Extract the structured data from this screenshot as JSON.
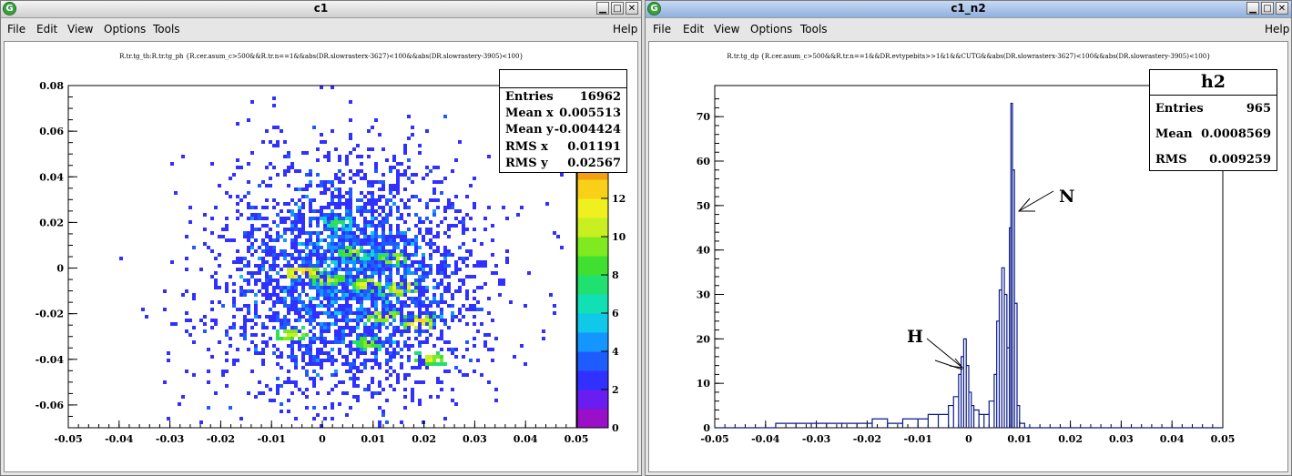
{
  "windows": [
    {
      "title": "c1",
      "menu": {
        "file": "File",
        "edit": "Edit",
        "view": "View",
        "options": "Options",
        "tools": "Tools",
        "help": "Help"
      }
    },
    {
      "title": "c1_n2",
      "menu": {
        "file": "File",
        "edit": "Edit",
        "view": "View",
        "options": "Options",
        "tools": "Tools",
        "help": "Help"
      }
    }
  ],
  "plot1": {
    "title": "R.tr.tg_th:R.tr.tg_ph {R.cer.asum_c>500&&R.tr.n==1&&abs(DR.slowrasterx-3627)<100&&abs(DR.slowrastery-3905)<100}",
    "stats": {
      "name": "",
      "rows": [
        {
          "label": "Entries",
          "value": "16962"
        },
        {
          "label": "Mean x",
          "value": "0.005513"
        },
        {
          "label": "Mean y",
          "value": "-0.004424"
        },
        {
          "label": "RMS x",
          "value": "0.01191"
        },
        {
          "label": "RMS y",
          "value": "0.02567"
        }
      ]
    }
  },
  "plot2": {
    "title": "R.tr.tg_dp {R.cer.asum_c>500&&R.tr.n==1&&DR.evtypebits>>1&1&&CUTG&&abs(DR.slowrasterx-3627)<100&&abs(DR.slowrastery-3905)<100}",
    "stats": {
      "name": "h2",
      "rows": [
        {
          "label": "Entries",
          "value": "965"
        },
        {
          "label": "Mean",
          "value": "0.0008569"
        },
        {
          "label": "RMS",
          "value": "0.009259"
        }
      ]
    },
    "annotations": {
      "n_label": "N",
      "h_label": "H"
    }
  },
  "chart_data": [
    {
      "type": "heatmap",
      "title": "R.tr.tg_th:R.tr.tg_ph {R.cer.asum_c>500&&R.tr.n==1&&abs(DR.slowrasterx-3627)<100&&abs(DR.slowrastery-3905)<100}",
      "xlim": [
        -0.05,
        0.05
      ],
      "ylim": [
        -0.07,
        0.08
      ],
      "x_ticks": [
        "-0.05",
        "-0.04",
        "-0.03",
        "-0.02",
        "-0.01",
        "0",
        "0.01",
        "0.02",
        "0.03",
        "0.04",
        "0.05"
      ],
      "y_ticks": [
        "0.08",
        "0.06",
        "0.04",
        "0.02",
        "0",
        "-0.02",
        "-0.04",
        "-0.06"
      ],
      "colorbar_ticks": [
        "0",
        "2",
        "4",
        "6",
        "8",
        "10",
        "12"
      ],
      "colorbar_range": [
        0,
        14
      ],
      "hotspots": [
        {
          "x": -0.004,
          "y": -0.002,
          "z": 13
        },
        {
          "x": 0.001,
          "y": -0.005,
          "z": 10
        },
        {
          "x": 0.009,
          "y": -0.007,
          "z": 11
        },
        {
          "x": 0.016,
          "y": -0.009,
          "z": 12
        },
        {
          "x": 0.012,
          "y": -0.021,
          "z": 11
        },
        {
          "x": 0.019,
          "y": -0.024,
          "z": 12
        },
        {
          "x": 0.014,
          "y": 0.004,
          "z": 10
        },
        {
          "x": 0.006,
          "y": 0.007,
          "z": 9
        },
        {
          "x": -0.006,
          "y": -0.029,
          "z": 10
        },
        {
          "x": 0.009,
          "y": -0.033,
          "z": 9
        },
        {
          "x": 0.021,
          "y": -0.04,
          "z": 10
        },
        {
          "x": 0.003,
          "y": 0.02,
          "z": 7
        }
      ]
    },
    {
      "type": "line",
      "title": "R.tr.tg_dp {R.cer.asum_c>500&&R.tr.n==1&&DR.evtypebits>>1&1&&CUTG&&abs(DR.slowrasterx-3627)<100&&abs(DR.slowrastery-3905)<100}",
      "xlim": [
        -0.05,
        0.05
      ],
      "ylim": [
        0,
        77
      ],
      "x_ticks": [
        "-0.05",
        "-0.04",
        "-0.03",
        "-0.02",
        "-0.01",
        "0",
        "0.01",
        "0.02",
        "0.03",
        "0.04",
        "0.05"
      ],
      "y_ticks": [
        "0",
        "10",
        "20",
        "30",
        "40",
        "50",
        "60",
        "70"
      ],
      "x": [
        -0.038,
        -0.034,
        -0.031,
        -0.028,
        -0.025,
        -0.022,
        -0.019,
        -0.016,
        -0.013,
        -0.01,
        -0.008,
        -0.006,
        -0.004,
        -0.003,
        -0.002,
        -0.0015,
        -0.001,
        -0.0005,
        0.0,
        0.0005,
        0.001,
        0.002,
        0.003,
        0.004,
        0.005,
        0.0055,
        0.006,
        0.0065,
        0.007,
        0.0075,
        0.008,
        0.0083,
        0.0086,
        0.009,
        0.0095,
        0.01,
        0.011
      ],
      "values": [
        1,
        1,
        1,
        1,
        1,
        1,
        2,
        1,
        2,
        2,
        3,
        3,
        5,
        7,
        12,
        16,
        20,
        14,
        8,
        5,
        4,
        3,
        3,
        6,
        12,
        24,
        31,
        36,
        30,
        18,
        45,
        73,
        58,
        28,
        5,
        1,
        0
      ]
    }
  ]
}
